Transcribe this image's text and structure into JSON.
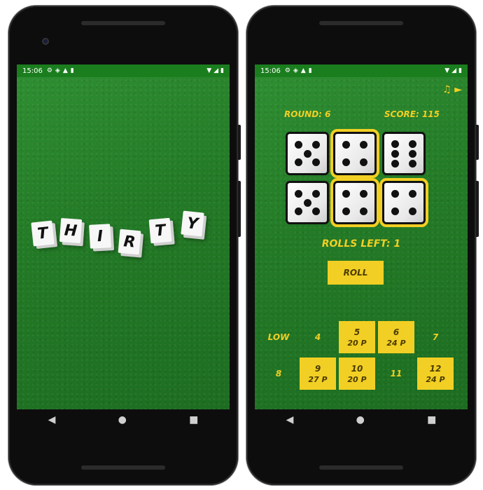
{
  "status": {
    "time": "15:06",
    "icons": [
      "⚙",
      "◈",
      "▲",
      "▮"
    ],
    "right": [
      "▼",
      "◢",
      "▮"
    ]
  },
  "nav": {
    "back": "◀",
    "home": "●",
    "recents": "■"
  },
  "title_letters": [
    "T",
    "H",
    "I",
    "R",
    "T",
    "Y"
  ],
  "game": {
    "round_label": "ROUND: 6",
    "score_label": "SCORE: 115",
    "music_icon": "♫ ►",
    "dice": [
      {
        "value": 5,
        "selected": false
      },
      {
        "value": 4,
        "selected": true
      },
      {
        "value": 6,
        "selected": false
      },
      {
        "value": 5,
        "selected": false
      },
      {
        "value": 4,
        "selected": true
      },
      {
        "value": 4,
        "selected": true
      }
    ],
    "rolls_left": "ROLLS LEFT: 1",
    "roll_label": "ROLL",
    "scores_row1": [
      {
        "label": "LOW",
        "points": "",
        "filled": false
      },
      {
        "label": "4",
        "points": "",
        "filled": false
      },
      {
        "label": "5",
        "points": "20 P",
        "filled": true
      },
      {
        "label": "6",
        "points": "24 P",
        "filled": true
      },
      {
        "label": "7",
        "points": "",
        "filled": false
      }
    ],
    "scores_row2": [
      {
        "label": "8",
        "points": "",
        "filled": false
      },
      {
        "label": "9",
        "points": "27 P",
        "filled": true
      },
      {
        "label": "10",
        "points": "20 P",
        "filled": true
      },
      {
        "label": "11",
        "points": "",
        "filled": false
      },
      {
        "label": "12",
        "points": "24 P",
        "filled": true
      }
    ]
  },
  "colors": {
    "felt": "#237a26",
    "accent": "#f2cf24",
    "statusbar": "#1b7e1e"
  }
}
